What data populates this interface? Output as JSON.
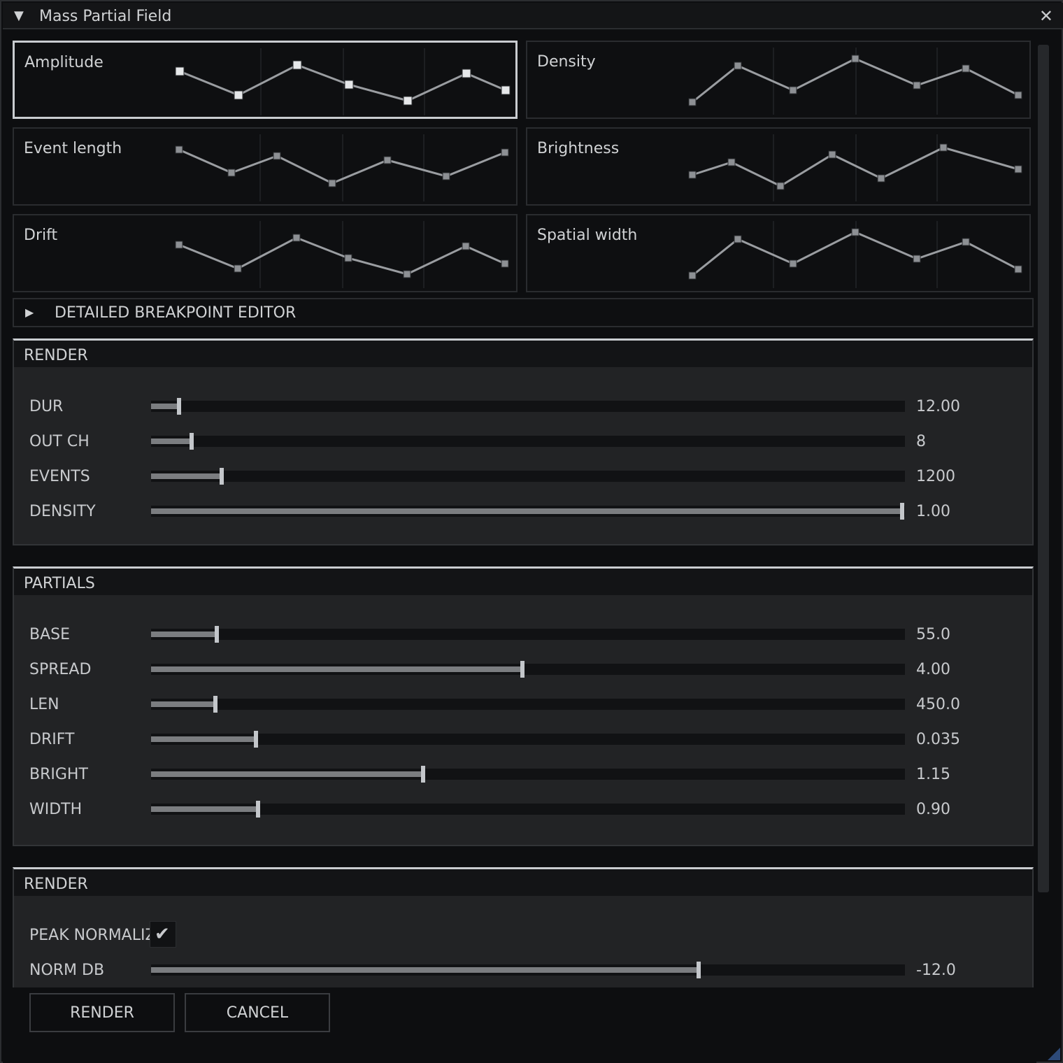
{
  "window": {
    "title": "Mass Partial Field",
    "collapse_glyph": "▼",
    "close_glyph": "✕"
  },
  "curves": [
    {
      "label": "Amplitude",
      "selected": true,
      "points": [
        [
          252,
          97
        ],
        [
          336,
          131
        ],
        [
          420,
          88
        ],
        [
          494,
          116
        ],
        [
          578,
          139
        ],
        [
          662,
          100
        ],
        [
          718,
          124
        ]
      ]
    },
    {
      "label": "Density",
      "selected": false,
      "points": [
        [
          986,
          142
        ],
        [
          1051,
          90
        ],
        [
          1130,
          125
        ],
        [
          1219,
          80
        ],
        [
          1307,
          118
        ],
        [
          1377,
          94
        ],
        [
          1452,
          132
        ]
      ]
    },
    {
      "label": "Event length",
      "selected": false,
      "points": [
        [
          252,
          210
        ],
        [
          327,
          243
        ],
        [
          392,
          219
        ],
        [
          471,
          258
        ],
        [
          550,
          225
        ],
        [
          634,
          248
        ],
        [
          718,
          214
        ]
      ]
    },
    {
      "label": "Brightness",
      "selected": false,
      "points": [
        [
          986,
          246
        ],
        [
          1042,
          228
        ],
        [
          1112,
          262
        ],
        [
          1186,
          217
        ],
        [
          1256,
          251
        ],
        [
          1345,
          207
        ],
        [
          1452,
          238
        ]
      ]
    },
    {
      "label": "Drift",
      "selected": false,
      "points": [
        [
          252,
          346
        ],
        [
          336,
          380
        ],
        [
          420,
          336
        ],
        [
          494,
          365
        ],
        [
          578,
          388
        ],
        [
          662,
          348
        ],
        [
          718,
          373
        ]
      ]
    },
    {
      "label": "Spatial width",
      "selected": false,
      "points": [
        [
          986,
          390
        ],
        [
          1051,
          338
        ],
        [
          1130,
          373
        ],
        [
          1219,
          328
        ],
        [
          1307,
          366
        ],
        [
          1377,
          342
        ],
        [
          1452,
          381
        ]
      ]
    }
  ],
  "breakpoint_editor": {
    "arrow_glyph": "▶",
    "label": "DETAILED BREAKPOINT EDITOR"
  },
  "render_section": {
    "title": "RENDER",
    "params": [
      {
        "label": "DUR",
        "value": "12.00",
        "level": 0.037
      },
      {
        "label": "OUT CH",
        "value": "8",
        "level": 0.054
      },
      {
        "label": "EVENTS",
        "value": "1200",
        "level": 0.094
      },
      {
        "label": "DENSITY",
        "value": "1.00",
        "level": 0.996
      }
    ]
  },
  "partials_section": {
    "title": "PARTIALS",
    "params": [
      {
        "label": "BASE",
        "value": "55.0",
        "level": 0.087
      },
      {
        "label": "SPREAD",
        "value": "4.00",
        "level": 0.493
      },
      {
        "label": "LEN",
        "value": "450.0",
        "level": 0.085
      },
      {
        "label": "DRIFT",
        "value": "0.035",
        "level": 0.139
      },
      {
        "label": "BRIGHT",
        "value": "1.15",
        "level": 0.361
      },
      {
        "label": "WIDTH",
        "value": "0.90",
        "level": 0.142
      }
    ]
  },
  "output_section": {
    "title": "RENDER",
    "peak_normalize": {
      "label": "PEAK NORMALIZE",
      "checked": true,
      "check_glyph": "✔"
    },
    "norm_db": {
      "label": "NORM DB",
      "value": "-12.0",
      "level": 0.726
    }
  },
  "buttons": {
    "render": "RENDER",
    "cancel": "CANCEL"
  },
  "colors": {
    "background": "#0d0e10",
    "panel": "#222325",
    "accent_border": "#c9ccd0",
    "curve_line": "#9a9da1",
    "curve_point_fill": "#c3c6ca",
    "slider_fill": "#7b7d80",
    "resize_grip": "#2d4a78"
  }
}
